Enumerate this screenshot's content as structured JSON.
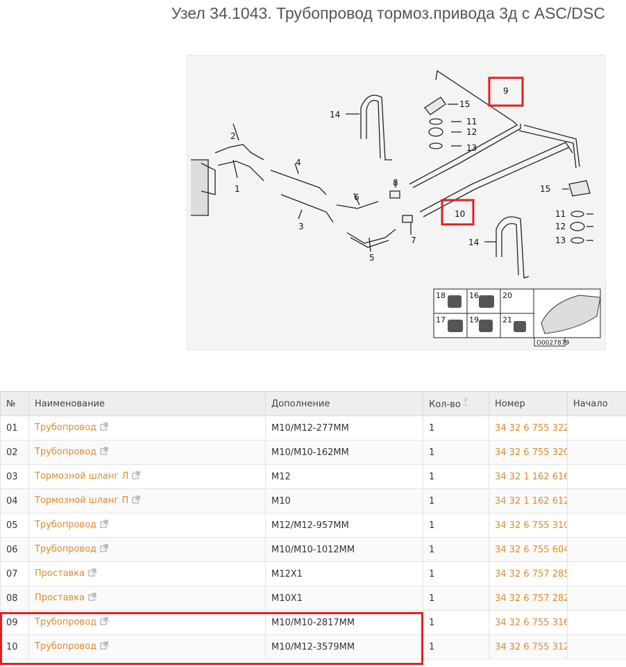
{
  "page": {
    "title": "Узел 34.1043. Трубопровод тормоз.привода 3д с ASC/DSC"
  },
  "diagram": {
    "code": "O0027879",
    "callouts": [
      "1",
      "2",
      "3",
      "4",
      "5",
      "6",
      "7",
      "8",
      "9",
      "10",
      "11",
      "12",
      "13",
      "14",
      "15"
    ],
    "inset_labels": [
      "16",
      "17",
      "18",
      "19",
      "20",
      "21"
    ],
    "highlighted_callouts": [
      "9",
      "10"
    ],
    "accent": "#e02020"
  },
  "table": {
    "headers": {
      "num": "№",
      "name": "Наименование",
      "extra": "Дополнение",
      "qty": "Кол-во",
      "qty_help": "?",
      "part_no": "Номер",
      "start": "Начало"
    },
    "rows": [
      {
        "num": "01",
        "name": "Трубопровод",
        "extra": "M10/M12-277MM",
        "qty": "1",
        "part_no": "34 32 6 755 322",
        "start": ""
      },
      {
        "num": "02",
        "name": "Трубопровод",
        "extra": "M10/M10-162MM",
        "qty": "1",
        "part_no": "34 32 6 755 320",
        "start": ""
      },
      {
        "num": "03",
        "name": "Тормозной шланг Л",
        "extra": "M12",
        "qty": "1",
        "part_no": "34 32 1 162 616",
        "start": ""
      },
      {
        "num": "04",
        "name": "Тормозной шланг П",
        "extra": "M10",
        "qty": "1",
        "part_no": "34 32 1 162 612",
        "start": ""
      },
      {
        "num": "05",
        "name": "Трубопровод",
        "extra": "M12/M12-957MM",
        "qty": "1",
        "part_no": "34 32 6 755 310",
        "start": ""
      },
      {
        "num": "06",
        "name": "Трубопровод",
        "extra": "M10/M10-1012MM",
        "qty": "1",
        "part_no": "34 32 6 755 604",
        "start": ""
      },
      {
        "num": "07",
        "name": "Проставка",
        "extra": "M12X1",
        "qty": "1",
        "part_no": "34 32 6 757 285",
        "start": ""
      },
      {
        "num": "08",
        "name": "Проставка",
        "extra": "M10X1",
        "qty": "1",
        "part_no": "34 32 6 757 282",
        "start": ""
      },
      {
        "num": "09",
        "name": "Трубопровод",
        "extra": "M10/M10-2817MM",
        "qty": "1",
        "part_no": "34 32 6 755 316",
        "start": ""
      },
      {
        "num": "10",
        "name": "Трубопровод",
        "extra": "M10/M12-3579MM",
        "qty": "1",
        "part_no": "34 32 6 755 312",
        "start": ""
      }
    ],
    "link_color": "#e0892b"
  }
}
